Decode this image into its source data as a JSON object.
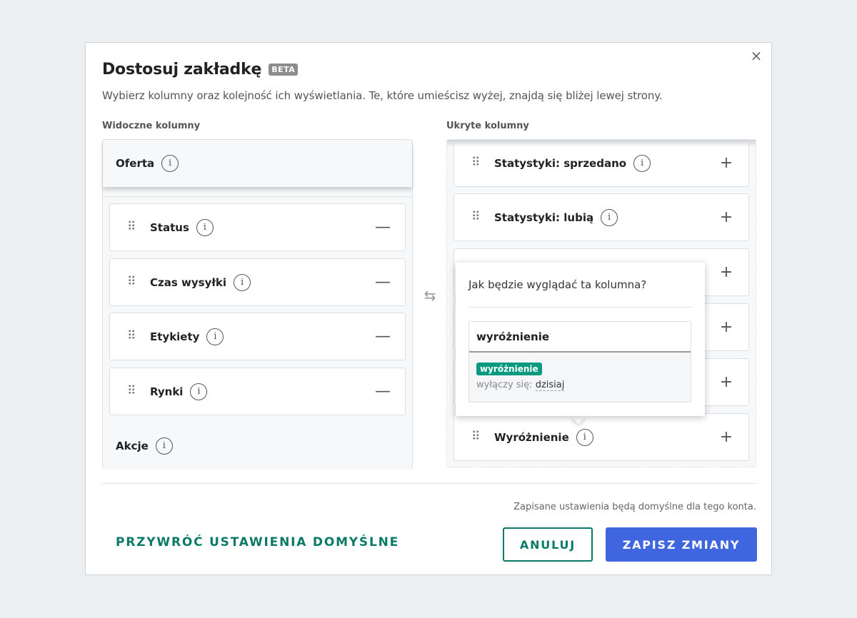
{
  "dialog": {
    "title": "Dostosuj zakładkę",
    "badge": "BETA",
    "subtitle": "Wybierz kolumny oraz kolejność ich wyświetlania. Te, które umieścisz wyżej, znajdą się bliżej lewej strony.",
    "close_icon": "×"
  },
  "visible": {
    "label": "Widoczne kolumny",
    "fixed_top": "Oferta",
    "fixed_bottom": "Akcje",
    "items": [
      {
        "label": "Status",
        "action": "—"
      },
      {
        "label": "Czas wysyłki",
        "action": "—"
      },
      {
        "label": "Etykiety",
        "action": "—"
      },
      {
        "label": "Rynki",
        "action": "—"
      }
    ]
  },
  "hidden": {
    "label": "Ukryte kolumny",
    "items": [
      {
        "label": "Statystyki: sprzedano",
        "action": "+"
      },
      {
        "label": "Statystyki: lubią",
        "action": "+"
      },
      {
        "label": "",
        "action": "+"
      },
      {
        "label": "",
        "action": "+"
      },
      {
        "label": "",
        "action": "+"
      },
      {
        "label": "Wyróżnienie",
        "action": "+"
      }
    ]
  },
  "icons": {
    "drag": "⠿",
    "info": "i",
    "swap": "⇆"
  },
  "popover": {
    "title": "Jak będzie wyglądać ta kolumna?",
    "column_header": "wyróżnienie",
    "badge": "wyróżnienie",
    "sub_prefix": "wyłączy się:",
    "sub_value": "dzisiaj"
  },
  "footer": {
    "note": "Zapisane ustawienia będą domyślne dla tego konta.",
    "restore_label": "PRZYWRÓĆ USTAWIENIA DOMYŚLNE",
    "cancel_label": "ANULUJ",
    "save_label": "ZAPISZ ZMIANY"
  },
  "colors": {
    "accent_green": "#0a7a66",
    "primary_blue": "#3f65df",
    "badge_green": "#0a9a82"
  }
}
